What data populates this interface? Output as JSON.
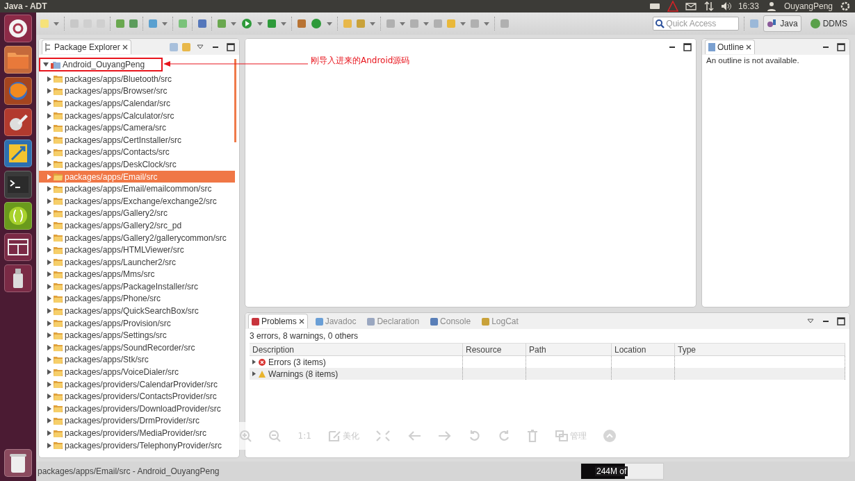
{
  "top_bar": {
    "title": "Java - ADT",
    "time": "16:33",
    "user": "OuyangPeng"
  },
  "toolbar": {
    "quick_access": {
      "placeholder": "Quick Access"
    },
    "perspectives": [
      {
        "label": "Java",
        "selected": true
      },
      {
        "label": "DDMS",
        "selected": false
      }
    ]
  },
  "package_explorer": {
    "title": "Package Explorer",
    "tree": [
      {
        "label": "Android_OuyangPeng",
        "expanded": true,
        "selected": false,
        "children": [
          {
            "label": "packages/apps/Bluetooth/src",
            "selected": false
          },
          {
            "label": "packages/apps/Browser/src",
            "selected": false
          },
          {
            "label": "packages/apps/Calendar/src",
            "selected": false
          },
          {
            "label": "packages/apps/Calculator/src",
            "selected": false
          },
          {
            "label": "packages/apps/Camera/src",
            "selected": false
          },
          {
            "label": "packages/apps/CertInstaller/src",
            "selected": false
          },
          {
            "label": "packages/apps/Contacts/src",
            "selected": false
          },
          {
            "label": "packages/apps/DeskClock/src",
            "selected": false
          },
          {
            "label": "packages/apps/Email/src",
            "selected": true
          },
          {
            "label": "packages/apps/Email/emailcommon/src",
            "selected": false
          },
          {
            "label": "packages/apps/Exchange/exchange2/src",
            "selected": false
          },
          {
            "label": "packages/apps/Gallery2/src",
            "selected": false
          },
          {
            "label": "packages/apps/Gallery2/src_pd",
            "selected": false
          },
          {
            "label": "packages/apps/Gallery2/gallerycommon/src",
            "selected": false
          },
          {
            "label": "packages/apps/HTMLViewer/src",
            "selected": false
          },
          {
            "label": "packages/apps/Launcher2/src",
            "selected": false
          },
          {
            "label": "packages/apps/Mms/src",
            "selected": false
          },
          {
            "label": "packages/apps/PackageInstaller/src",
            "selected": false
          },
          {
            "label": "packages/apps/Phone/src",
            "selected": false
          },
          {
            "label": "packages/apps/QuickSearchBox/src",
            "selected": false
          },
          {
            "label": "packages/apps/Provision/src",
            "selected": false
          },
          {
            "label": "packages/apps/Settings/src",
            "selected": false
          },
          {
            "label": "packages/apps/SoundRecorder/src",
            "selected": false
          },
          {
            "label": "packages/apps/Stk/src",
            "selected": false
          },
          {
            "label": "packages/apps/VoiceDialer/src",
            "selected": false
          },
          {
            "label": "packages/providers/CalendarProvider/src",
            "selected": false
          },
          {
            "label": "packages/providers/ContactsProvider/src",
            "selected": false
          },
          {
            "label": "packages/providers/DownloadProvider/src",
            "selected": false
          },
          {
            "label": "packages/providers/DrmProvider/src",
            "selected": false
          },
          {
            "label": "packages/providers/MediaProvider/src",
            "selected": false
          },
          {
            "label": "packages/providers/TelephonyProvider/src",
            "selected": false
          }
        ]
      }
    ]
  },
  "annotation": {
    "text": "刚导入进来的Android源码"
  },
  "outline": {
    "title": "Outline",
    "message": "An outline is not available."
  },
  "bottom_panel": {
    "tabs": [
      {
        "label": "Problems",
        "selected": true
      },
      {
        "label": "Javadoc",
        "selected": false
      },
      {
        "label": "Declaration",
        "selected": false
      },
      {
        "label": "Console",
        "selected": false
      },
      {
        "label": "LogCat",
        "selected": false
      }
    ],
    "summary": "3 errors, 8 warnings, 0 others",
    "columns": [
      "Description",
      "Resource",
      "Path",
      "Location",
      "Type"
    ],
    "rows": [
      {
        "kind": "error",
        "label": "Errors (3 items)"
      },
      {
        "kind": "warning",
        "label": "Warnings (8 items)"
      }
    ]
  },
  "viewer_toolbar": {
    "items": [
      {
        "kind": "zoom_in"
      },
      {
        "kind": "zoom_out"
      },
      {
        "kind": "text",
        "label": "1:1"
      },
      {
        "kind": "edit",
        "label": "美化"
      },
      {
        "kind": "fit"
      },
      {
        "kind": "prev"
      },
      {
        "kind": "next"
      },
      {
        "kind": "rotate_left"
      },
      {
        "kind": "rotate_right"
      },
      {
        "kind": "delete"
      },
      {
        "kind": "manage",
        "label": "管理"
      },
      {
        "kind": "collapse"
      }
    ]
  },
  "status_bar": {
    "text": "packages/apps/Email/src - Android_OuyangPeng",
    "heap": {
      "reading": "244M of",
      "level": 0.53
    }
  }
}
